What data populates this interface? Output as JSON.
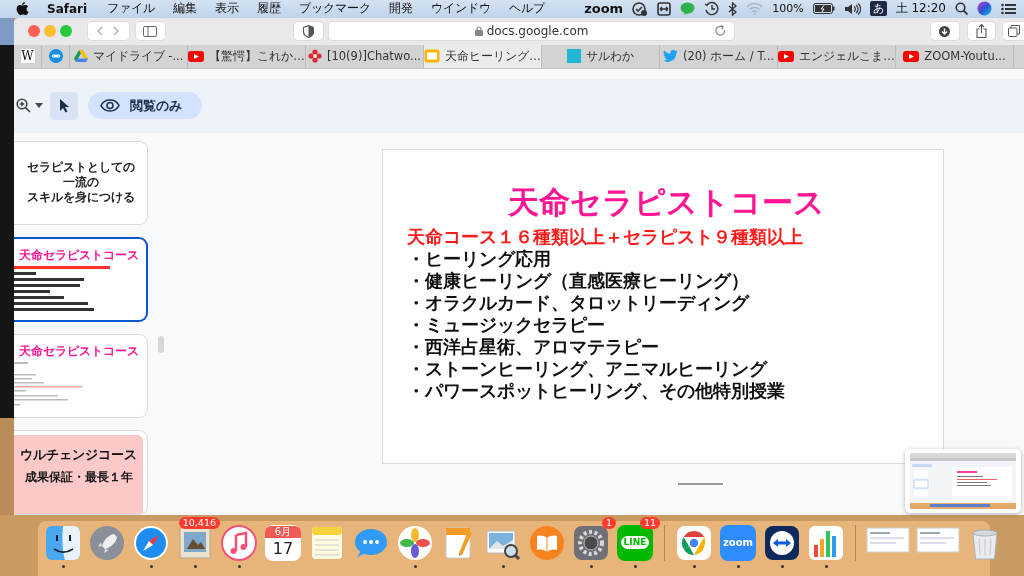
{
  "menu_bar": {
    "app": "Safari",
    "menus": [
      "ファイル",
      "編集",
      "表示",
      "履歴",
      "ブックマーク",
      "開発",
      "ウインドウ",
      "ヘルプ"
    ],
    "zoom_label": "zoom",
    "battery": "100%",
    "input_method": "あ",
    "clock": "土 12:20"
  },
  "browser": {
    "url": "docs.google.com",
    "pinned_tabs": [
      {
        "kind": "wikipedia",
        "glyph": "W"
      },
      {
        "kind": "infinity"
      }
    ],
    "tabs": [
      {
        "title": "マイドライブ -...",
        "kind": "drive",
        "selected": false
      },
      {
        "title": "【驚愕】これか…",
        "kind": "youtube",
        "selected": false
      },
      {
        "title": "[10(9)]Chatwo...",
        "kind": "chatwork",
        "selected": false
      },
      {
        "title": "天命ヒーリング…",
        "kind": "slides",
        "selected": true
      },
      {
        "title": "サルわか",
        "kind": "square",
        "selected": false
      },
      {
        "title": "(20) ホーム / T...",
        "kind": "twitter",
        "selected": false
      },
      {
        "title": "エンジェルこま…",
        "kind": "youtube",
        "selected": false
      },
      {
        "title": "ZOOM-Youtu...",
        "kind": "youtube",
        "selected": false
      }
    ]
  },
  "docs": {
    "tools": [
      {
        "kind": "zoom",
        "selected": false
      },
      {
        "kind": "pointer",
        "selected": true
      }
    ],
    "mode_label": "閲覧のみ",
    "slides": [
      {
        "kind": "text",
        "selected": false,
        "lines": [
          "セラピストとしての",
          "一流の",
          "スキルを身につける"
        ]
      },
      {
        "kind": "course",
        "selected": true,
        "title": "天命セラピストコース",
        "has_body": true
      },
      {
        "kind": "course",
        "selected": false,
        "title": "天命セラピストコース"
      },
      {
        "kind": "banner",
        "selected": false,
        "title": "ウルチェンジコース",
        "subtitle": "成果保証・最長１年"
      }
    ],
    "main_slide": {
      "title": "天命セラピストコース",
      "subtitle": "天命コース１６種類以上＋セラピスト９種類以上",
      "items": [
        "・ヒーリング応用",
        "・健康ヒーリング（直感医療ヒーリング）",
        "・オラクルカード、タロットリーディング",
        "・ミュージックセラピー",
        "・西洋占星術、アロマテラピー",
        "・ストーンヒーリング、アニマルヒーリング",
        "・パワースポットヒーリング、その他特別授業"
      ]
    }
  },
  "dock": {
    "items": [
      {
        "kind": "finder",
        "running": true
      },
      {
        "kind": "launchpad",
        "running": false
      },
      {
        "kind": "safari",
        "running": true
      },
      {
        "kind": "mail",
        "running": true,
        "badge": "10,416"
      },
      {
        "kind": "music",
        "running": true
      },
      {
        "kind": "calendar",
        "running": false,
        "month": "6月",
        "day": "17"
      },
      {
        "kind": "notes",
        "running": false
      },
      {
        "kind": "messages",
        "running": false
      },
      {
        "kind": "photos",
        "running": true
      },
      {
        "kind": "pages",
        "running": false
      },
      {
        "kind": "preview",
        "running": true
      },
      {
        "kind": "books",
        "running": false
      },
      {
        "kind": "settings",
        "running": true,
        "badge": "1"
      },
      {
        "kind": "line",
        "running": true,
        "label": "LINE",
        "badge": "11"
      },
      {
        "kind": "divider"
      },
      {
        "kind": "chrome",
        "running": true
      },
      {
        "kind": "zoom",
        "running": true,
        "label": "zoom"
      },
      {
        "kind": "teamviewer",
        "running": true
      },
      {
        "kind": "numbers",
        "running": true
      },
      {
        "kind": "divider"
      },
      {
        "kind": "document",
        "running": false
      },
      {
        "kind": "document",
        "running": false
      },
      {
        "kind": "trash",
        "running": false
      }
    ]
  }
}
